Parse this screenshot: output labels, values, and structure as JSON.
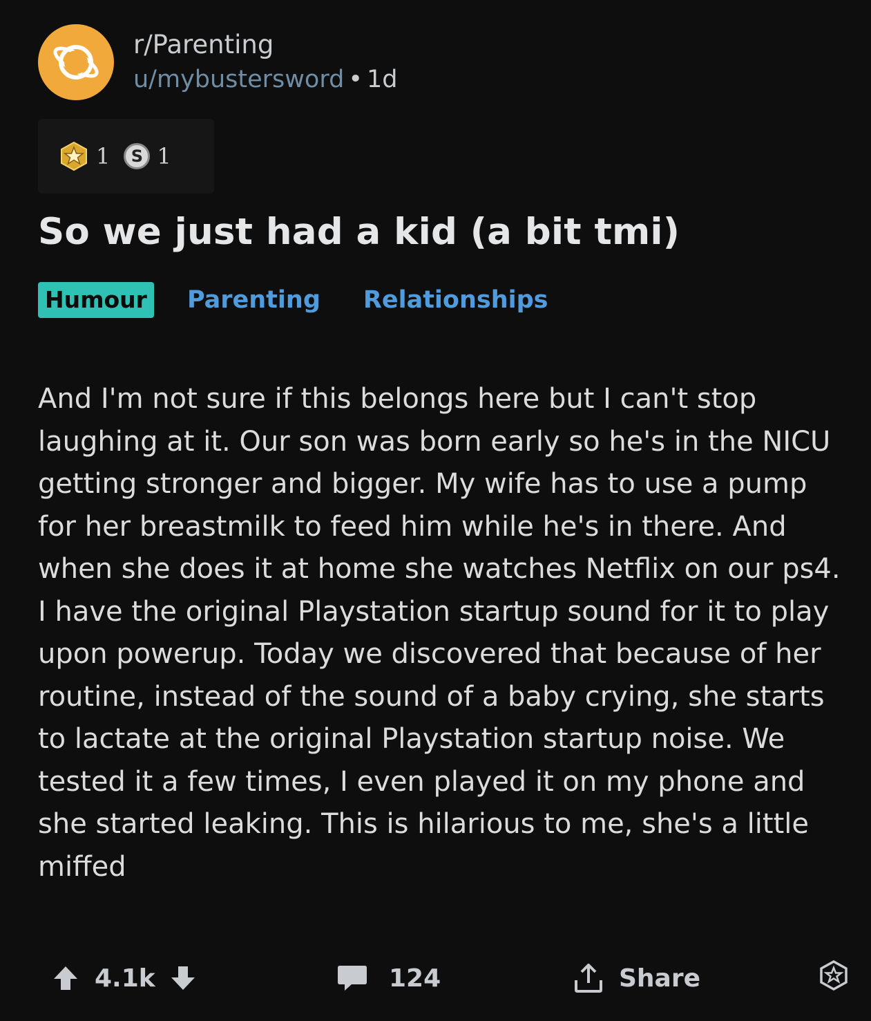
{
  "post": {
    "subreddit": "r/Parenting",
    "username": "u/mybustersword",
    "separator": "•",
    "age": "1d",
    "awards": [
      {
        "icon": "gold-star-award-icon",
        "count": "1"
      },
      {
        "icon": "silver-award-icon",
        "count": "1"
      }
    ],
    "title": "So we just had a kid (a bit tmi)",
    "flairs": [
      "Humour",
      "Parenting",
      "Relationships"
    ],
    "body": "And I'm not sure if this belongs here but I can't stop laughing at it. Our son was born early so he's in the NICU getting stronger and bigger. My wife has to use a pump for her breastmilk to feed him while he's in there. And when she does it at home she watches Netflix on our ps4. I have the original Playstation startup sound for it to play upon powerup. Today we discovered that because of her routine, instead of the sound of a baby crying, she starts to lactate at the original Playstation startup noise. We tested it a few times, I even played it on my phone and she started leaking. This is hilarious to me, she's a little miffed"
  },
  "actions": {
    "score": "4.1k",
    "comments": "124",
    "share_label": "Share"
  },
  "colors": {
    "background": "#0e0e0e",
    "username": "#6f8ea6",
    "flair_humour": "#2fc1b3",
    "flair_link": "#4f9bdc",
    "avatar": "#f2a93b"
  }
}
